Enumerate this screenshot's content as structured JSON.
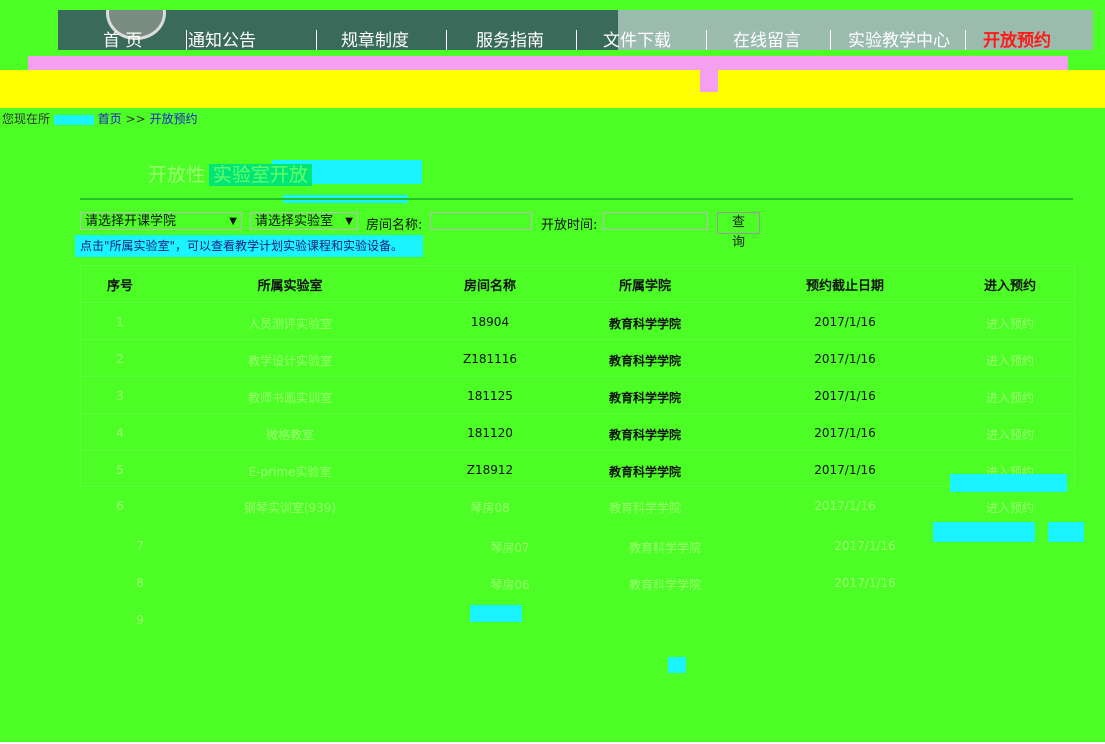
{
  "nav": {
    "items": [
      "首 页",
      "通知公告",
      "规章制度",
      "服务指南",
      "文件下载",
      "在线留言",
      "实验教学中心",
      "开放预约"
    ],
    "active_index": 7
  },
  "breadcrumb": {
    "prefix": "您现在所",
    "home": "首页",
    "sep": ">>",
    "current": "开放预约"
  },
  "section": {
    "title": "开放性",
    "title_highlight": "实验室开放"
  },
  "filters": {
    "college_select": "请选择开课学院",
    "lab_select": "请选择实验室",
    "room_label": "房间名称:",
    "room_value": "",
    "time_label": "开放时间:",
    "time_value": "",
    "query_button": "查询"
  },
  "hint": "点击\"所属实验室\"，可以查看教学计划实验课程和实验设备。",
  "table": {
    "headers": [
      "序号",
      "所属实验室",
      "房间名称",
      "所属学院",
      "预约截止日期",
      "进入预约"
    ],
    "rows": [
      {
        "no": "1",
        "lab": "人员测评实验室",
        "room": "18904",
        "college": "教育科学学院",
        "deadline": "2017/1/16",
        "action": "进入预约"
      },
      {
        "no": "2",
        "lab": "教学设计实验室",
        "room": "Z181116",
        "college": "教育科学学院",
        "deadline": "2017/1/16",
        "action": "进入预约"
      },
      {
        "no": "3",
        "lab": "教师书画实训室",
        "room": "181125",
        "college": "教育科学学院",
        "deadline": "2017/1/16",
        "action": "进入预约"
      },
      {
        "no": "4",
        "lab": "微格教室",
        "room": "181120",
        "college": "教育科学学院",
        "deadline": "2017/1/16",
        "action": "进入预约"
      },
      {
        "no": "5",
        "lab": "E-prime实验室",
        "room": "Z18912",
        "college": "教育科学学院",
        "deadline": "2017/1/16",
        "action": "进入预约"
      },
      {
        "no": "6",
        "lab": "钢琴实训室(939)",
        "room": "琴房08",
        "college": "教育科学学院",
        "deadline": "2017/1/16",
        "action": "进入预约"
      },
      {
        "no": "7",
        "lab": "",
        "room": "琴房07",
        "college": "教育科学学院",
        "deadline": "2017/1/16",
        "action": ""
      },
      {
        "no": "8",
        "lab": "",
        "room": "琴房06",
        "college": "教育科学学院",
        "deadline": "2017/1/16",
        "action": ""
      },
      {
        "no": "9",
        "lab": "",
        "room": "",
        "college": "",
        "deadline": "",
        "action": ""
      }
    ]
  },
  "colors": {
    "page_bg": "#4cfd26",
    "accent_cyan": "#19f4ff",
    "nav_active": "#ff1a1a",
    "pink": "#f49ff0",
    "yellow": "#ffff00"
  }
}
